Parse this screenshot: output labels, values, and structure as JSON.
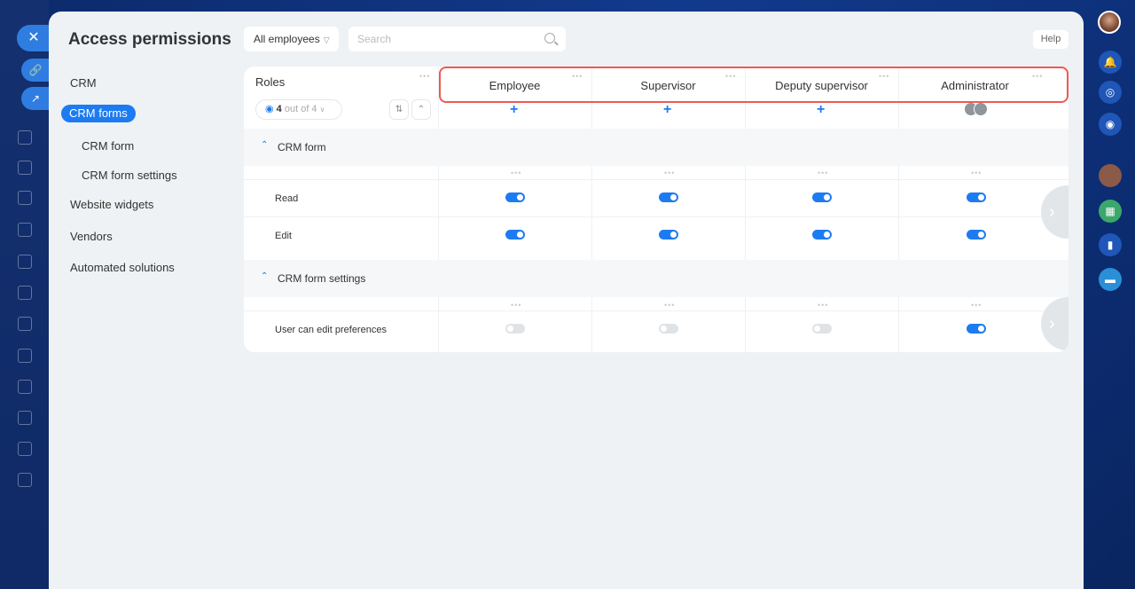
{
  "page": {
    "title": "Access permissions",
    "filter_label": "All employees",
    "search_placeholder": "Search",
    "help_label": "Help"
  },
  "nav": {
    "items": [
      "CRM",
      "CRM forms",
      "CRM form",
      "CRM form settings",
      "Website widgets",
      "Vendors",
      "Automated solutions"
    ]
  },
  "table": {
    "roles_label": "Roles",
    "roles_visible": "4",
    "roles_count_suffix": "out of 4",
    "columns": [
      "Employee",
      "Supervisor",
      "Deputy supervisor",
      "Administrator"
    ],
    "sections": [
      {
        "title": "CRM form",
        "rows": [
          {
            "label": "Read",
            "values": [
              true,
              true,
              true,
              true
            ]
          },
          {
            "label": "Edit",
            "values": [
              true,
              true,
              true,
              true
            ]
          }
        ]
      },
      {
        "title": "CRM form settings",
        "rows": [
          {
            "label": "User can edit preferences",
            "values": [
              false,
              false,
              false,
              true
            ]
          }
        ]
      }
    ]
  },
  "colors": {
    "accent": "#1d7bf2",
    "highlight": "#ef5a52"
  }
}
